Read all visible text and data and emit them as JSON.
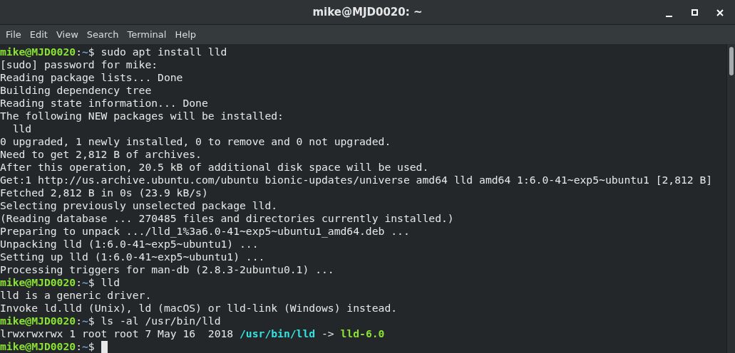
{
  "window": {
    "title": "mike@MJD0020: ~"
  },
  "menu": [
    "File",
    "Edit",
    "View",
    "Search",
    "Terminal",
    "Help"
  ],
  "lines": [
    {
      "segments": [
        {
          "kind": "user",
          "text": "mike@MJD0020"
        },
        {
          "kind": "plain",
          "text": ":"
        },
        {
          "kind": "path",
          "text": "~"
        },
        {
          "kind": "plain",
          "text": "$ sudo apt install lld"
        }
      ]
    },
    {
      "segments": [
        {
          "kind": "plain",
          "text": "[sudo] password for mike:"
        }
      ]
    },
    {
      "segments": [
        {
          "kind": "plain",
          "text": "Reading package lists... Done"
        }
      ]
    },
    {
      "segments": [
        {
          "kind": "plain",
          "text": "Building dependency tree"
        }
      ]
    },
    {
      "segments": [
        {
          "kind": "plain",
          "text": "Reading state information... Done"
        }
      ]
    },
    {
      "segments": [
        {
          "kind": "plain",
          "text": "The following NEW packages will be installed:"
        }
      ]
    },
    {
      "segments": [
        {
          "kind": "plain",
          "text": "  lld"
        }
      ]
    },
    {
      "segments": [
        {
          "kind": "plain",
          "text": "0 upgraded, 1 newly installed, 0 to remove and 0 not upgraded."
        }
      ]
    },
    {
      "segments": [
        {
          "kind": "plain",
          "text": "Need to get 2,812 B of archives."
        }
      ]
    },
    {
      "segments": [
        {
          "kind": "plain",
          "text": "After this operation, 20.5 kB of additional disk space will be used."
        }
      ]
    },
    {
      "segments": [
        {
          "kind": "plain",
          "text": "Get:1 http://us.archive.ubuntu.com/ubuntu bionic-updates/universe amd64 lld amd64 1:6.0-41~exp5~ubuntu1 [2,812 B]"
        }
      ]
    },
    {
      "segments": [
        {
          "kind": "plain",
          "text": "Fetched 2,812 B in 0s (23.9 kB/s)"
        }
      ]
    },
    {
      "segments": [
        {
          "kind": "plain",
          "text": "Selecting previously unselected package lld."
        }
      ]
    },
    {
      "segments": [
        {
          "kind": "plain",
          "text": "(Reading database ... 270485 files and directories currently installed.)"
        }
      ]
    },
    {
      "segments": [
        {
          "kind": "plain",
          "text": "Preparing to unpack .../lld_1%3a6.0-41~exp5~ubuntu1_amd64.deb ..."
        }
      ]
    },
    {
      "segments": [
        {
          "kind": "plain",
          "text": "Unpacking lld (1:6.0-41~exp5~ubuntu1) ..."
        }
      ]
    },
    {
      "segments": [
        {
          "kind": "plain",
          "text": "Setting up lld (1:6.0-41~exp5~ubuntu1) ..."
        }
      ]
    },
    {
      "segments": [
        {
          "kind": "plain",
          "text": "Processing triggers for man-db (2.8.3-2ubuntu0.1) ..."
        }
      ]
    },
    {
      "segments": [
        {
          "kind": "user",
          "text": "mike@MJD0020"
        },
        {
          "kind": "plain",
          "text": ":"
        },
        {
          "kind": "path",
          "text": "~"
        },
        {
          "kind": "plain",
          "text": "$ lld"
        }
      ]
    },
    {
      "segments": [
        {
          "kind": "plain",
          "text": "lld is a generic driver."
        }
      ]
    },
    {
      "segments": [
        {
          "kind": "plain",
          "text": "Invoke ld.lld (Unix), ld (macOS) or lld-link (Windows) instead."
        }
      ]
    },
    {
      "segments": [
        {
          "kind": "user",
          "text": "mike@MJD0020"
        },
        {
          "kind": "plain",
          "text": ":"
        },
        {
          "kind": "path",
          "text": "~"
        },
        {
          "kind": "plain",
          "text": "$ ls -al /usr/bin/lld"
        }
      ]
    },
    {
      "segments": [
        {
          "kind": "plain",
          "text": "lrwxrwxrwx 1 root root 7 May 16  2018 "
        },
        {
          "kind": "dir",
          "text": "/usr/bin/lld"
        },
        {
          "kind": "plain",
          "text": " -> "
        },
        {
          "kind": "exec",
          "text": "lld-6.0"
        }
      ]
    },
    {
      "cursor": true,
      "segments": [
        {
          "kind": "user",
          "text": "mike@MJD0020"
        },
        {
          "kind": "plain",
          "text": ":"
        },
        {
          "kind": "path",
          "text": "~"
        },
        {
          "kind": "plain",
          "text": "$ "
        }
      ]
    }
  ]
}
